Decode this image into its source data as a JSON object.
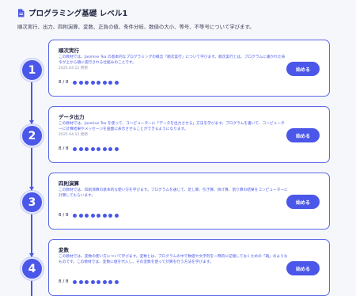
{
  "page": {
    "title": "プログラミング基礎 レベル1",
    "subtitle": "順次実行、出力、四則演算、変数、正負の値、条件分岐、数値の大小、等号、不等号について学びます。",
    "title_icon": "document-icon"
  },
  "colors": {
    "accent": "#4a57e8",
    "text": "#1f2340",
    "muted": "#8a8fb0",
    "background": "#f6f7fb"
  },
  "lessons": [
    {
      "number": "1",
      "title": "順次実行",
      "description": "この教材では、Jasmine Tea の基本的なプログラミングの概念「順次実行」について学びます。順次実行とは、プログラムに書かれた命令が上から順に実行される仕組みのことです。",
      "date": "2025.04.12 更新",
      "progress_text": "8 / 8",
      "progress_done": 8,
      "progress_total": 8,
      "button": "始める"
    },
    {
      "number": "2",
      "title": "データ出力",
      "description": "この教材では、Jasmine Tea を使って、コンピューターに「データを出力させる」方法を学びます。プログラムを書いて、コンピューターに計算結果やメッセージを画面に表示させることができるようになります。",
      "date": "2025.04.12 更新",
      "progress_text": "8 / 8",
      "progress_done": 8,
      "progress_total": 8,
      "button": "始める"
    },
    {
      "number": "3",
      "title": "四則演算",
      "description": "この教材では、四則演算の基本的な使い方を学びます。プログラムを通じて、足し算、引き算、掛け算、割り算の結果をコンピューターに計算してもらいます。",
      "date": "",
      "progress_text": "8 / 8",
      "progress_done": 8,
      "progress_total": 8,
      "button": "始める"
    },
    {
      "number": "4",
      "title": "変数",
      "description": "この教材では、変数の使い方について学びます。変数とは、プログラムの中で数値や文字列を一時的に記憶しておくための「箱」のようなものです。この教材では、変数に値を代入し、その変数を使って計算を行う方法を学びます。",
      "date": "",
      "progress_text": "8 / 8",
      "progress_done": 8,
      "progress_total": 8,
      "button": "始める"
    }
  ]
}
